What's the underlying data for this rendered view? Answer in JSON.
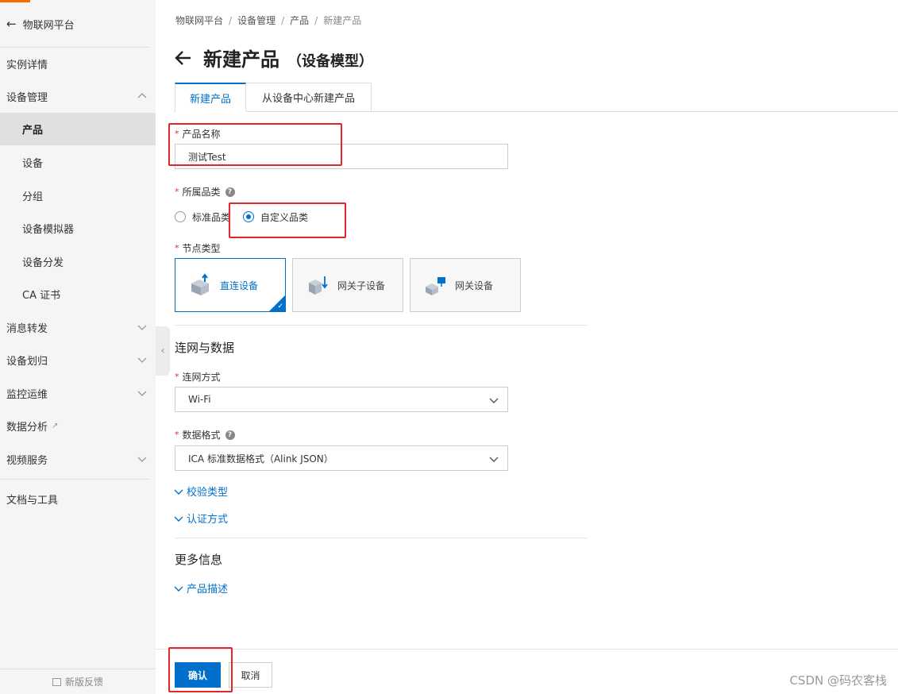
{
  "sidebar": {
    "back_label": "物联网平台",
    "items": [
      {
        "label": "实例详情",
        "level": 1
      },
      {
        "label": "设备管理",
        "level": 1,
        "expanded": true
      },
      {
        "label": "产品",
        "level": 2,
        "active": true
      },
      {
        "label": "设备",
        "level": 2
      },
      {
        "label": "分组",
        "level": 2
      },
      {
        "label": "设备模拟器",
        "level": 2
      },
      {
        "label": "设备分发",
        "level": 2
      },
      {
        "label": "CA 证书",
        "level": 2
      },
      {
        "label": "消息转发",
        "level": 1,
        "expanded": false
      },
      {
        "label": "设备划归",
        "level": 1,
        "expanded": false
      },
      {
        "label": "监控运维",
        "level": 1,
        "expanded": false
      },
      {
        "label": "数据分析",
        "level": 1,
        "external": true
      },
      {
        "label": "视频服务",
        "level": 1,
        "expanded": false
      },
      {
        "label": "文档与工具",
        "level": 1
      }
    ],
    "feedback_label": "新版反馈"
  },
  "breadcrumb": [
    "物联网平台",
    "设备管理",
    "产品",
    "新建产品"
  ],
  "page": {
    "title": "新建产品",
    "subtitle": "（设备模型）"
  },
  "tabs": [
    {
      "label": "新建产品",
      "active": true
    },
    {
      "label": "从设备中心新建产品",
      "active": false
    }
  ],
  "form": {
    "product_name": {
      "label": "产品名称",
      "value": "测试Test"
    },
    "category": {
      "label": "所属品类",
      "options": [
        {
          "label": "标准品类",
          "checked": false
        },
        {
          "label": "自定义品类",
          "checked": true
        }
      ]
    },
    "node_type": {
      "label": "节点类型",
      "options": [
        {
          "label": "直连设备",
          "selected": true
        },
        {
          "label": "网关子设备",
          "selected": false
        },
        {
          "label": "网关设备",
          "selected": false
        }
      ]
    },
    "network_section_title": "连网与数据",
    "network_method": {
      "label": "连网方式",
      "value": "Wi-Fi"
    },
    "data_format": {
      "label": "数据格式",
      "value": "ICA 标准数据格式（Alink JSON）"
    },
    "verify_type_label": "校验类型",
    "auth_method_label": "认证方式",
    "more_section_title": "更多信息",
    "product_desc_label": "产品描述"
  },
  "footer": {
    "confirm_label": "确认",
    "cancel_label": "取消"
  },
  "watermark": "CSDN @码农客栈",
  "colors": {
    "primary": "#0070cc",
    "annotation": "#e3262b",
    "required": "#e62e2e"
  }
}
